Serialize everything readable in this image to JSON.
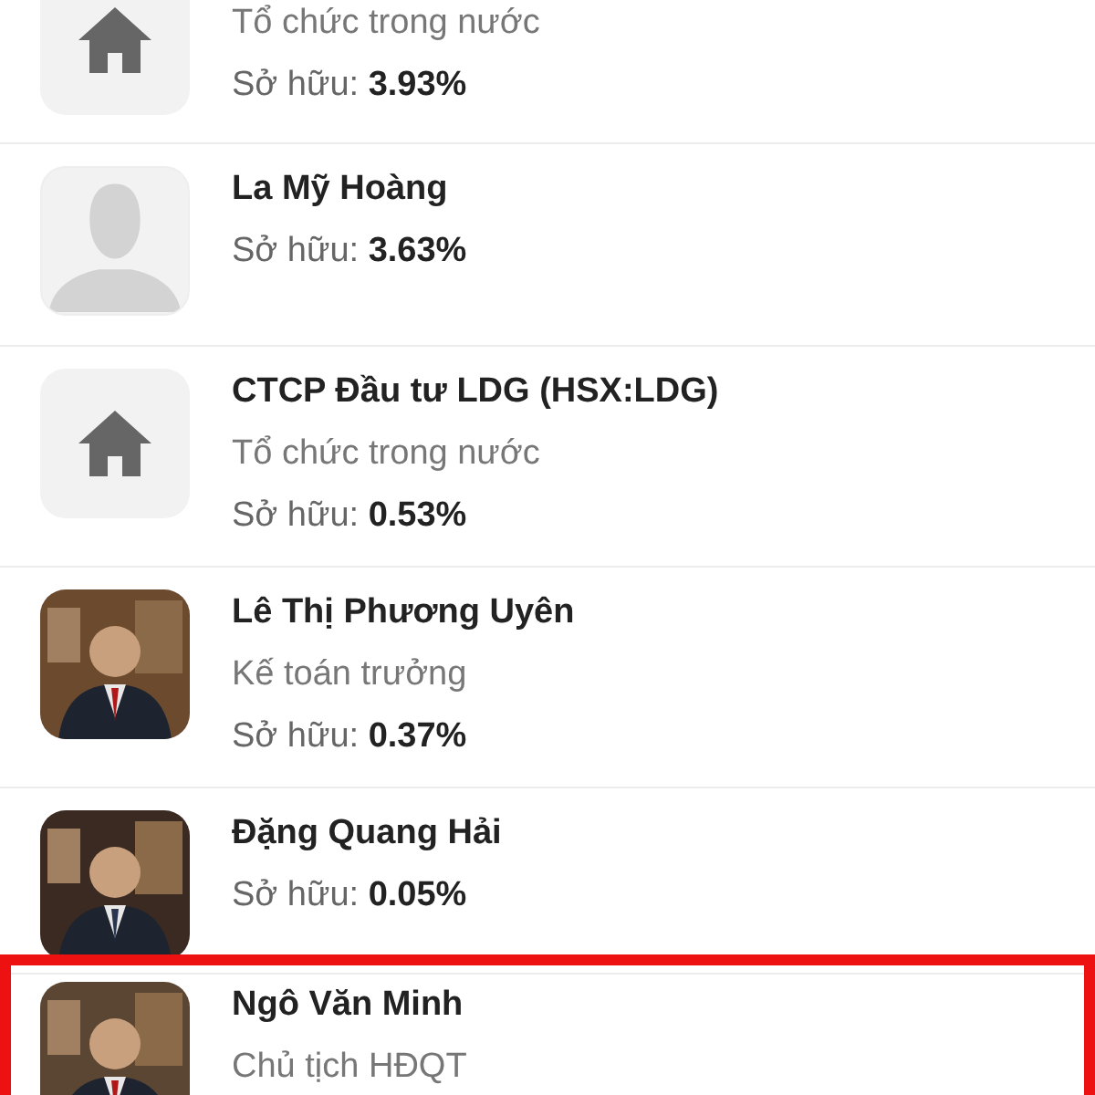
{
  "shareholders": [
    {
      "kind": "building",
      "cut_top": true,
      "role": "Tổ chức trong nước",
      "ownership": "Sở hữu: **3.93%**",
      "highlighted": false
    },
    {
      "kind": "placeholder",
      "name": "La Mỹ Hoàng",
      "ownership": "Sở hữu: **3.63%**",
      "highlighted": false
    },
    {
      "kind": "building",
      "name": "CTCP Đầu tư LDG (HSX:LDG)",
      "role": "Tổ chức trong nước",
      "ownership": "Sở hữu: **0.53%**",
      "highlighted": false
    },
    {
      "name": "Lê Thị Phương Uyên",
      "role": "Kế toán trưởng",
      "ownership": "Sở hữu: **0.37%**",
      "highlighted": false
    },
    {
      "name": "Đặng Quang Hải",
      "ownership": "Sở hữu: **0.05%**",
      "highlighted": false
    },
    {
      "name": "Ngô Văn Minh",
      "role": "Chủ tịch HĐQT",
      "highlighted": true
    }
  ]
}
